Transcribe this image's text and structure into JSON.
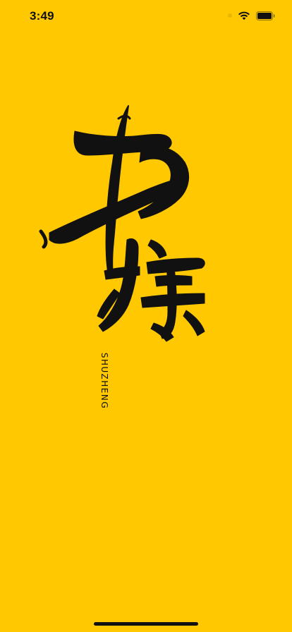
{
  "status_bar": {
    "time": "3:49",
    "icons": [
      "wifi-icon",
      "battery-icon"
    ]
  },
  "splash": {
    "logo_text": "SHUZHENG"
  },
  "colors": {
    "background": "#FFC800",
    "ink": "#111111"
  }
}
